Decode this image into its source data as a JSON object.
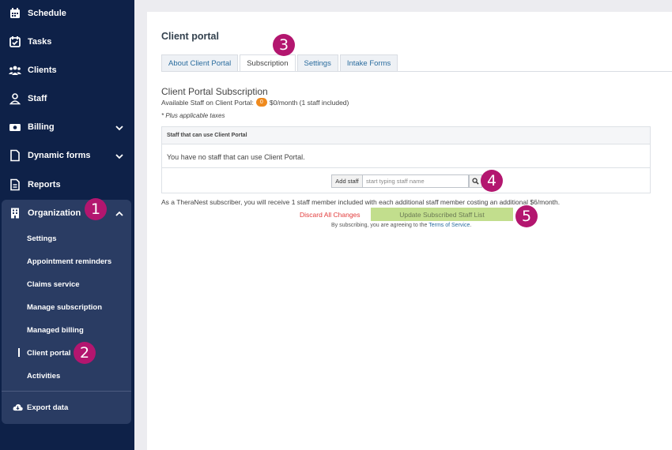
{
  "sidebar": {
    "items": [
      {
        "label": "Schedule",
        "icon": "calendar-icon"
      },
      {
        "label": "Tasks",
        "icon": "task-check-icon"
      },
      {
        "label": "Clients",
        "icon": "clients-group-icon"
      },
      {
        "label": "Staff",
        "icon": "staff-person-icon"
      },
      {
        "label": "Billing",
        "icon": "billing-money-icon"
      },
      {
        "label": "Dynamic forms",
        "icon": "document-icon"
      },
      {
        "label": "Reports",
        "icon": "report-icon"
      },
      {
        "label": "Organization",
        "icon": "building-icon"
      }
    ],
    "org_subitems": [
      {
        "label": "Settings"
      },
      {
        "label": "Appointment reminders"
      },
      {
        "label": "Claims service"
      },
      {
        "label": "Manage subscription"
      },
      {
        "label": "Managed billing"
      },
      {
        "label": "Client portal"
      },
      {
        "label": "Activities"
      }
    ],
    "export_label": "Export data"
  },
  "badges": [
    "1",
    "2",
    "3",
    "4",
    "5"
  ],
  "main": {
    "title": "Client portal",
    "tabs": [
      {
        "label": "About Client Portal"
      },
      {
        "label": "Subscription"
      },
      {
        "label": "Settings"
      },
      {
        "label": "Intake Forms"
      }
    ],
    "subscription_title": "Client Portal Subscription",
    "available_prefix": "Available Staff on Client Portal:",
    "available_count": "0",
    "available_suffix": "$0/month (1 staff included)",
    "tax_note": "* Plus applicable taxes",
    "table_header": "Staff that can use Client Portal",
    "no_staff_text": "You have no staff that can use Client Portal.",
    "add_staff_label": "Add staff",
    "search_placeholder": "start typing staff name",
    "subscriber_note": "As a TheraNest subscriber, you will receive 1 staff member included with each additional staff member costing an additional $6/month.",
    "discard_label": "Discard All Changes",
    "update_label": "Update Subscribed Staff List",
    "terms_prefix": "By subscribing, you are agreeing to the",
    "terms_link": "Terms of Service",
    "terms_suffix": "."
  },
  "colors": {
    "sidebar_bg": "#0e2148",
    "org_panel_bg": "#2a3c63",
    "badge": "#b3166f",
    "update_button": "#c2de8d",
    "discard_link": "#e23b3b",
    "count_pill": "#ef8a1e"
  }
}
